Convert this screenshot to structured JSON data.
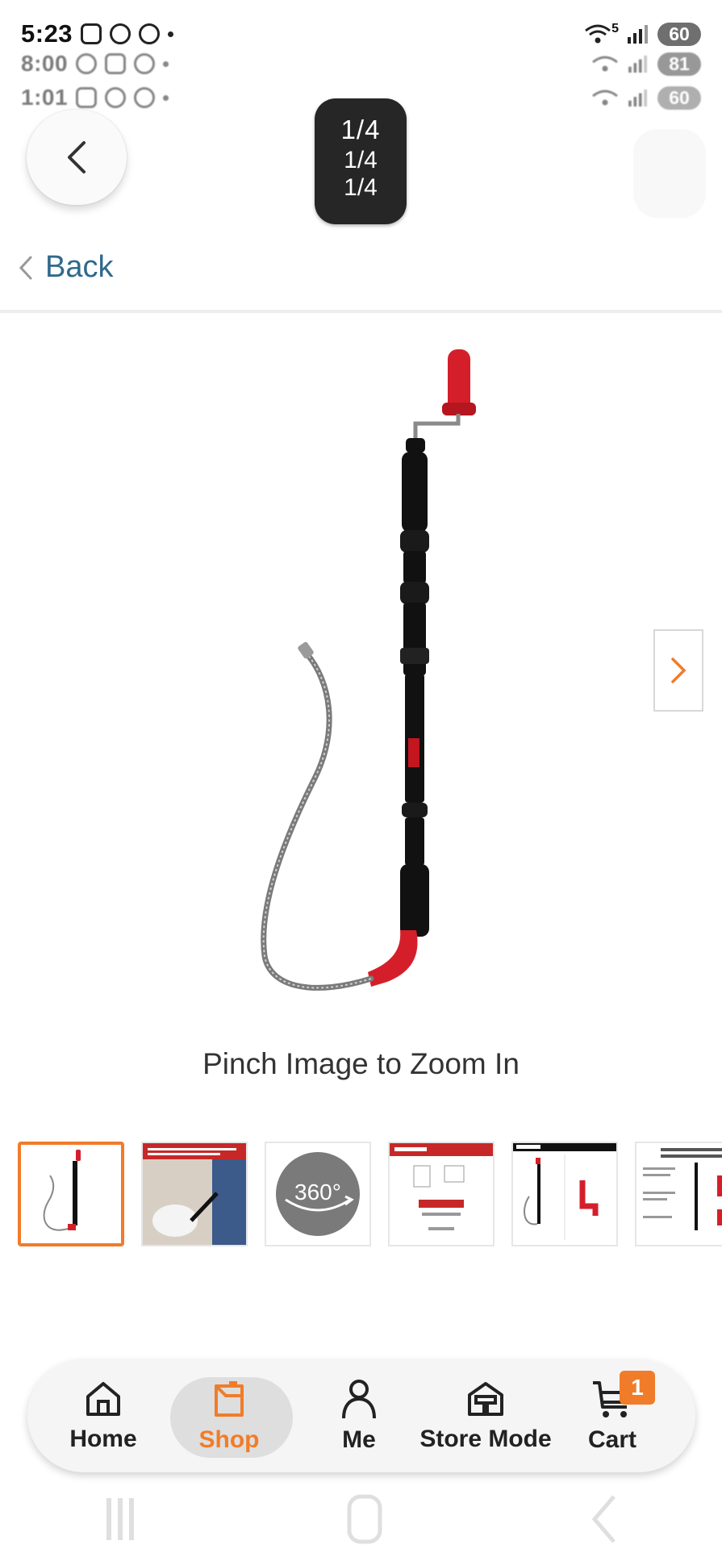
{
  "status_bar": [
    {
      "time": "5:23",
      "battery": "60",
      "net": "5"
    },
    {
      "time": "8:00",
      "battery": "81",
      "net": ""
    },
    {
      "time": "1:01",
      "battery": "60",
      "net": ""
    }
  ],
  "header": {
    "image_counter": "1/4",
    "image_counter_echo_1": "1/4",
    "image_counter_echo_2": "1/4",
    "back_link_label": "Back"
  },
  "gallery": {
    "zoom_hint": "Pinch Image to Zoom In",
    "thumb_360_label": "360°",
    "thumbnails": [
      {
        "kind": "product",
        "selected": true
      },
      {
        "kind": "lifestyle",
        "selected": false
      },
      {
        "kind": "360",
        "selected": false
      },
      {
        "kind": "ideal-use",
        "selected": false
      },
      {
        "kind": "kit-includes",
        "selected": false
      },
      {
        "kind": "spec-sheet",
        "selected": false
      }
    ]
  },
  "bottom_nav": {
    "items": [
      {
        "label": "Home",
        "icon": "home-icon"
      },
      {
        "label": "Shop",
        "icon": "shop-icon",
        "active": true
      },
      {
        "label": "Me",
        "icon": "person-icon"
      },
      {
        "label": "Store Mode",
        "icon": "store-icon"
      },
      {
        "label": "Cart",
        "icon": "cart-icon"
      }
    ],
    "cart_count": "1"
  },
  "colors": {
    "accent": "#f07c2a",
    "link": "#2f6a8c",
    "tool_red": "#d41f2b"
  }
}
